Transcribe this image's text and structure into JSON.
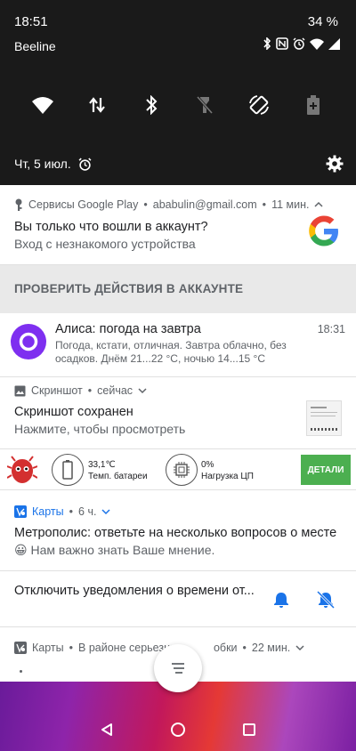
{
  "status_bar": {
    "time": "18:51",
    "battery_percent": "34 %",
    "carrier": "Beeline"
  },
  "quick_settings": {
    "tiles": [
      "wifi-icon",
      "data-transfer-icon",
      "bluetooth-icon",
      "flashlight-off-icon",
      "auto-rotate-icon",
      "battery-saver-icon"
    ]
  },
  "date_row": {
    "date": "Чт, 5 июл."
  },
  "google_notif": {
    "app": "Сервисы Google Play",
    "account": "ababulin@gmail.com",
    "time": "11 мин.",
    "title": "Вы только что вошли в аккаунт?",
    "text": "Вход с незнакомого устройства"
  },
  "action_bar": {
    "label": "ПРОВЕРИТЬ ДЕЙСТВИЯ В АККАУНТЕ"
  },
  "alice_notif": {
    "title": "Алиса: погода на завтра",
    "time": "18:31",
    "text_line1": "Погода, кстати, отличная. Завтра облачно, без",
    "text_line2": "осадков. Днём 21...22 °С, ночью 14...15 °С"
  },
  "screenshot_notif": {
    "app": "Скриншот",
    "time": "сейчас",
    "title": "Скриншот сохранен",
    "text": "Нажмите, чтобы просмотреть"
  },
  "antutu": {
    "temp_value": "33,1℃",
    "temp_label": "Темп. батареи",
    "cpu_value": "0%",
    "cpu_label": "Нагрузка ЦП",
    "details_label": "ДЕТАЛИ"
  },
  "maps_notif": {
    "app": "Карты",
    "time": "6 ч.",
    "title": "Метрополис: ответьте на несколько вопросов о месте",
    "emoji": "😀",
    "text": "Нам важно знать Ваше мнение."
  },
  "disable_notif": {
    "title": "Отключить уведомления о времени от..."
  },
  "maps_notif2": {
    "app": "Карты",
    "text": "В районе серьезны",
    "text_end": "обки",
    "time": "22 мин."
  },
  "colors": {
    "accent_blue": "#1a73e8",
    "alice_purple": "#7e2ff0",
    "details_green": "#4caf50",
    "antutu_red": "#d32f2f"
  }
}
